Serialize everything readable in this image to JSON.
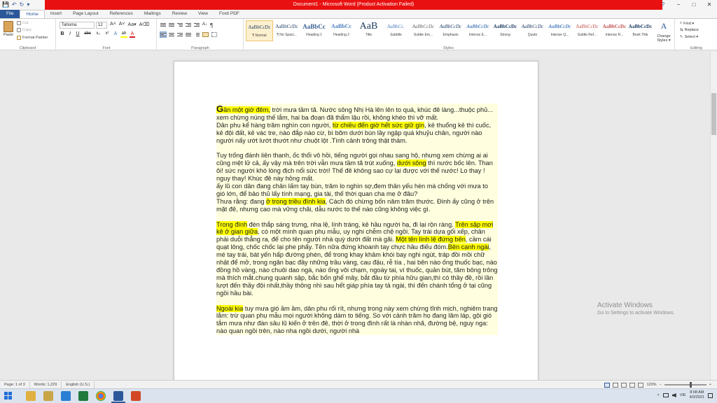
{
  "window": {
    "title": "Document1 - Microsoft Word (Product Activation Failed)",
    "help_glyph": "?",
    "minimize_glyph": "−",
    "maximize_glyph": "□",
    "close_glyph": "✕"
  },
  "quick_access": {
    "save_glyph": "💾",
    "undo_glyph": "↶",
    "redo_glyph": "↻",
    "customize_glyph": "▾"
  },
  "tabs": [
    "File",
    "Home",
    "Insert",
    "Page Layout",
    "References",
    "Mailings",
    "Review",
    "View",
    "Foxit PDF"
  ],
  "ribbon": {
    "clipboard": {
      "label": "Clipboard",
      "paste": "Paste",
      "cut": "Cut",
      "copy": "Copy",
      "format_painter": "Format Painter"
    },
    "font": {
      "label": "Font",
      "font_name": "Tahoma",
      "font_size": "12",
      "grow": "A˄",
      "shrink": "A˅",
      "change_case": "Aa▾",
      "clear_format": "A⌫",
      "bold": "B",
      "italic": "I",
      "underline": "U",
      "strike": "abc",
      "subscript": "x₂",
      "superscript": "x²",
      "text_effects": "A",
      "highlight": "ab",
      "font_color": "A"
    },
    "paragraph": {
      "label": "Paragraph",
      "show_marks": "¶",
      "sort": "A↓"
    },
    "styles": {
      "label": "Styles",
      "items": [
        {
          "sample": "AaBbCcDc",
          "name": "¶ Normal"
        },
        {
          "sample": "AaBbCcDc",
          "name": "¶ No Spaci..."
        },
        {
          "sample": "AaBbCc",
          "name": "Heading 1"
        },
        {
          "sample": "AaBbCc",
          "name": "Heading 2"
        },
        {
          "sample": "AaB",
          "name": "Title"
        },
        {
          "sample": "AaBbCc.",
          "name": "Subtitle"
        },
        {
          "sample": "AaBbCcDc",
          "name": "Subtle Em..."
        },
        {
          "sample": "AaBbCcDc",
          "name": "Emphasis"
        },
        {
          "sample": "AaBbCcDc",
          "name": "Intense E..."
        },
        {
          "sample": "AaBbCcDc",
          "name": "Strong"
        },
        {
          "sample": "AaBbCcDc",
          "name": "Quote"
        },
        {
          "sample": "AaBbCcDc",
          "name": "Intense Q..."
        },
        {
          "sample": "AaBbCcDc",
          "name": "Subtle Ref..."
        },
        {
          "sample": "AaBbCcDc",
          "name": "Intense R..."
        },
        {
          "sample": "AaBbCcDc",
          "name": "Book Title"
        }
      ],
      "change_styles": "Change Styles ▾"
    },
    "editing": {
      "label": "Editing",
      "find": "Find ▾",
      "replace": "Replace",
      "select": "Select ▾"
    }
  },
  "document": {
    "p1": {
      "dropcap": "G",
      "highlight": "ần một giờ đêm,",
      "text": " trời mưa tầm tã. Nước sông Nhị Hà lên lên to quá, khúc đê làng...thuộc phủ... xem chừng núng thế lắm, hai ba đoạn đã thẩm lậu rồi, không khéo thì vỡ mất."
    },
    "p2": {
      "a": "Dân phu kể hàng trăm nghìn con người, ",
      "h1": "từ chiều đến giờ hết sức giữ gìn",
      "b": ", kẻ thuổng kẻ thì cuốc, kẻ đội đất, kẻ vác tre, nào đắp nào cừ, bì bõm dưới bùn lầy ngập quá khuỷu chân, người nào người nấy ướt lướt thướt như chuột lột .Tình cảnh trông thật thảm."
    },
    "p3": {
      "a": "Tuy trống đánh liên thanh, ốc thổi vô hồi, tiếng người gọi nhau sang hộ, nhưng xem chừng ai ai cũng mệt lử cả, ấy vậy mà trên trời vẫn mưa tầm tã trút xuống, ",
      "h1": "dưới sông",
      "b": " thì nước bốc lên. Than ôi! sức người khó lòng địch nổi sức trời! Thế đê không sao cự lại được với thế nước! Lo thay ! nguy thay! Khúc đê này hỏng mất."
    },
    "p4": "ấy lũ con dân đang chân lấm tay bùn, trăm lo nghìn sợ,đem thân yếu hèn mà chống với mưa to gió lớn, để bảo thủ lấy tính mạng, gia tài, thế thời quan cha mẹ ở đâu?",
    "p5": {
      "a": "Thưa rằng: đang ",
      "h1": "ở trong triều đình kia",
      "b": ", Cách đó chừng bốn năm trăm thước. Đình ấy cũng ở trên mặt đê, nhưng cao mà vững chãi, dẫu nước to thế nào cũng không việc gì."
    },
    "p6": {
      "h1": "Trong đình",
      "a": " đèn thắp sáng trưng, nha lệ, lính tráng, kẻ hầu người hạ, đi lại rộn ràng. ",
      "h2": "Trên sập mơi kê ở gian giữa",
      "b": ", có một mình quan phụ mẫu, uy nghi chễm chệ ngồi. Tay trái dựa gối xếp, chân phải duỗi thẳng ra, để cho tên người nhà quỳ dưới đất mà gãi. ",
      "h3": "Một tên lính lệ đứng bên",
      "c": ", cầm cái quạt lông, chốc chốc lại phe phẩy. Tên nữa đứng khoanh tay chực hầu điếu đóm.",
      "h4": "Bên cạnh ngài",
      "d": ", mé tay trái, bát yến hấp đường phèn, để trong khay khảm khói bay nghi ngút, tráp đồi mồi chữ nhật để mở, trong ngăn bạc đầy những trầu vàng, cau đậu, rễ tía , hai bên nào ống thuốc bạc, nào đồng hồ vàng, nào chuôi dao ngà, nào ống vôi chạm, ngoáy tai, ví thuốc, quản bút, tăm bông trông mà thích mắt.chung quanh sập, bắc bốn ghế mây, bắt đầu từ phía hữu gian,thì có thầy đề, rồi lần lượt đến thầy đội nhất,thầy thông nhì sau hết giáp phía tay tả ngài, thì đến chánh tổng ở tại cũng ngồi hầu bài."
    },
    "p7": {
      "h1": "Ngoài kia",
      "a": " tuy mưa gió ầm ầm, dân phu rối rít, nhưng trong này xem chừng tĩnh mịch, nghiêm trang lắm: trừ quan phụ mẫu mọi người không dám to tiếng. So với cảnh trăm họ đang lăm láp, gội gió tắm mưa như đàn sâu lũ kiến ở trên đê, thời ở trong đình rất là nhàn nhã, đường bệ, nguy nga: nào quan ngồi trên, nào nha ngồi dưới, người nhà"
    }
  },
  "watermark": {
    "line1": "Activate Windows",
    "line2": "Go to Settings to activate Windows."
  },
  "statusbar": {
    "page": "Page: 1 of 3",
    "words": "Words: 1,229",
    "language": "English (U.S.)",
    "zoom": "120%",
    "zoom_minus": "−",
    "zoom_plus": "+"
  },
  "taskbar": {
    "time": "8:08 AM",
    "date": "4/3/2021",
    "lang": "VIE",
    "tray_arrow": "˄"
  },
  "colors": {
    "accent": "#2b579a",
    "title_red": "#e81010",
    "highlight": "#ffff00",
    "text_bg": "#ffffe0"
  }
}
